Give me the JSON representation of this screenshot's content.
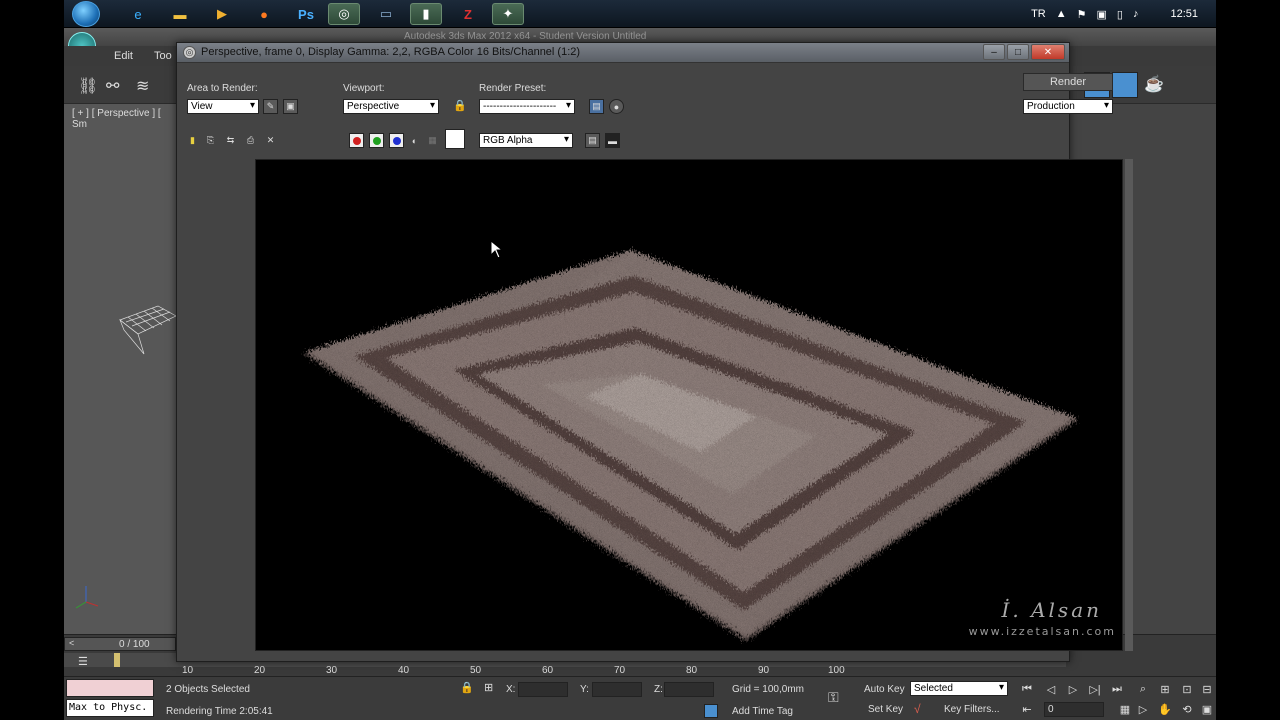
{
  "taskbar": {
    "tray_lang": "TR",
    "clock": "12:51"
  },
  "max": {
    "title": "Autodesk 3ds Max 2012 x64 - Student Version  Untitled",
    "menu": [
      "Edit",
      "Too"
    ],
    "viewport_label": "[ + ] [ Perspective ] [ Sm"
  },
  "render_frame": {
    "title": "Perspective, frame 0, Display Gamma: 2,2, RGBA Color 16 Bits/Channel (1:2)",
    "area_label": "Area to Render:",
    "area_value": "View",
    "viewport_label": "Viewport:",
    "viewport_value": "Perspective",
    "preset_label": "Render Preset:",
    "preset_value": "----------------------",
    "render_button": "Render",
    "render_mode": "Production",
    "channel_value": "RGB Alpha",
    "watermark_sig": "İ. Alsan",
    "watermark_url": "www.izzetalsan.com"
  },
  "timeline": {
    "frame_counter": "0 / 100",
    "ticks": [
      "10",
      "20",
      "30",
      "40",
      "50",
      "60",
      "70",
      "80",
      "90",
      "100"
    ]
  },
  "status": {
    "script_listener": "Max to Physc.",
    "selected": "2 Objects Selected",
    "rendering_time": "Rendering Time  2:05:41",
    "x_label": "X:",
    "y_label": "Y:",
    "z_label": "Z:",
    "grid": "Grid = 100,0mm",
    "add_time_tag": "Add Time Tag",
    "auto_key": "Auto Key",
    "set_key": "Set Key",
    "selected_dd": "Selected",
    "key_filters": "Key Filters...",
    "frame_field": "0"
  }
}
